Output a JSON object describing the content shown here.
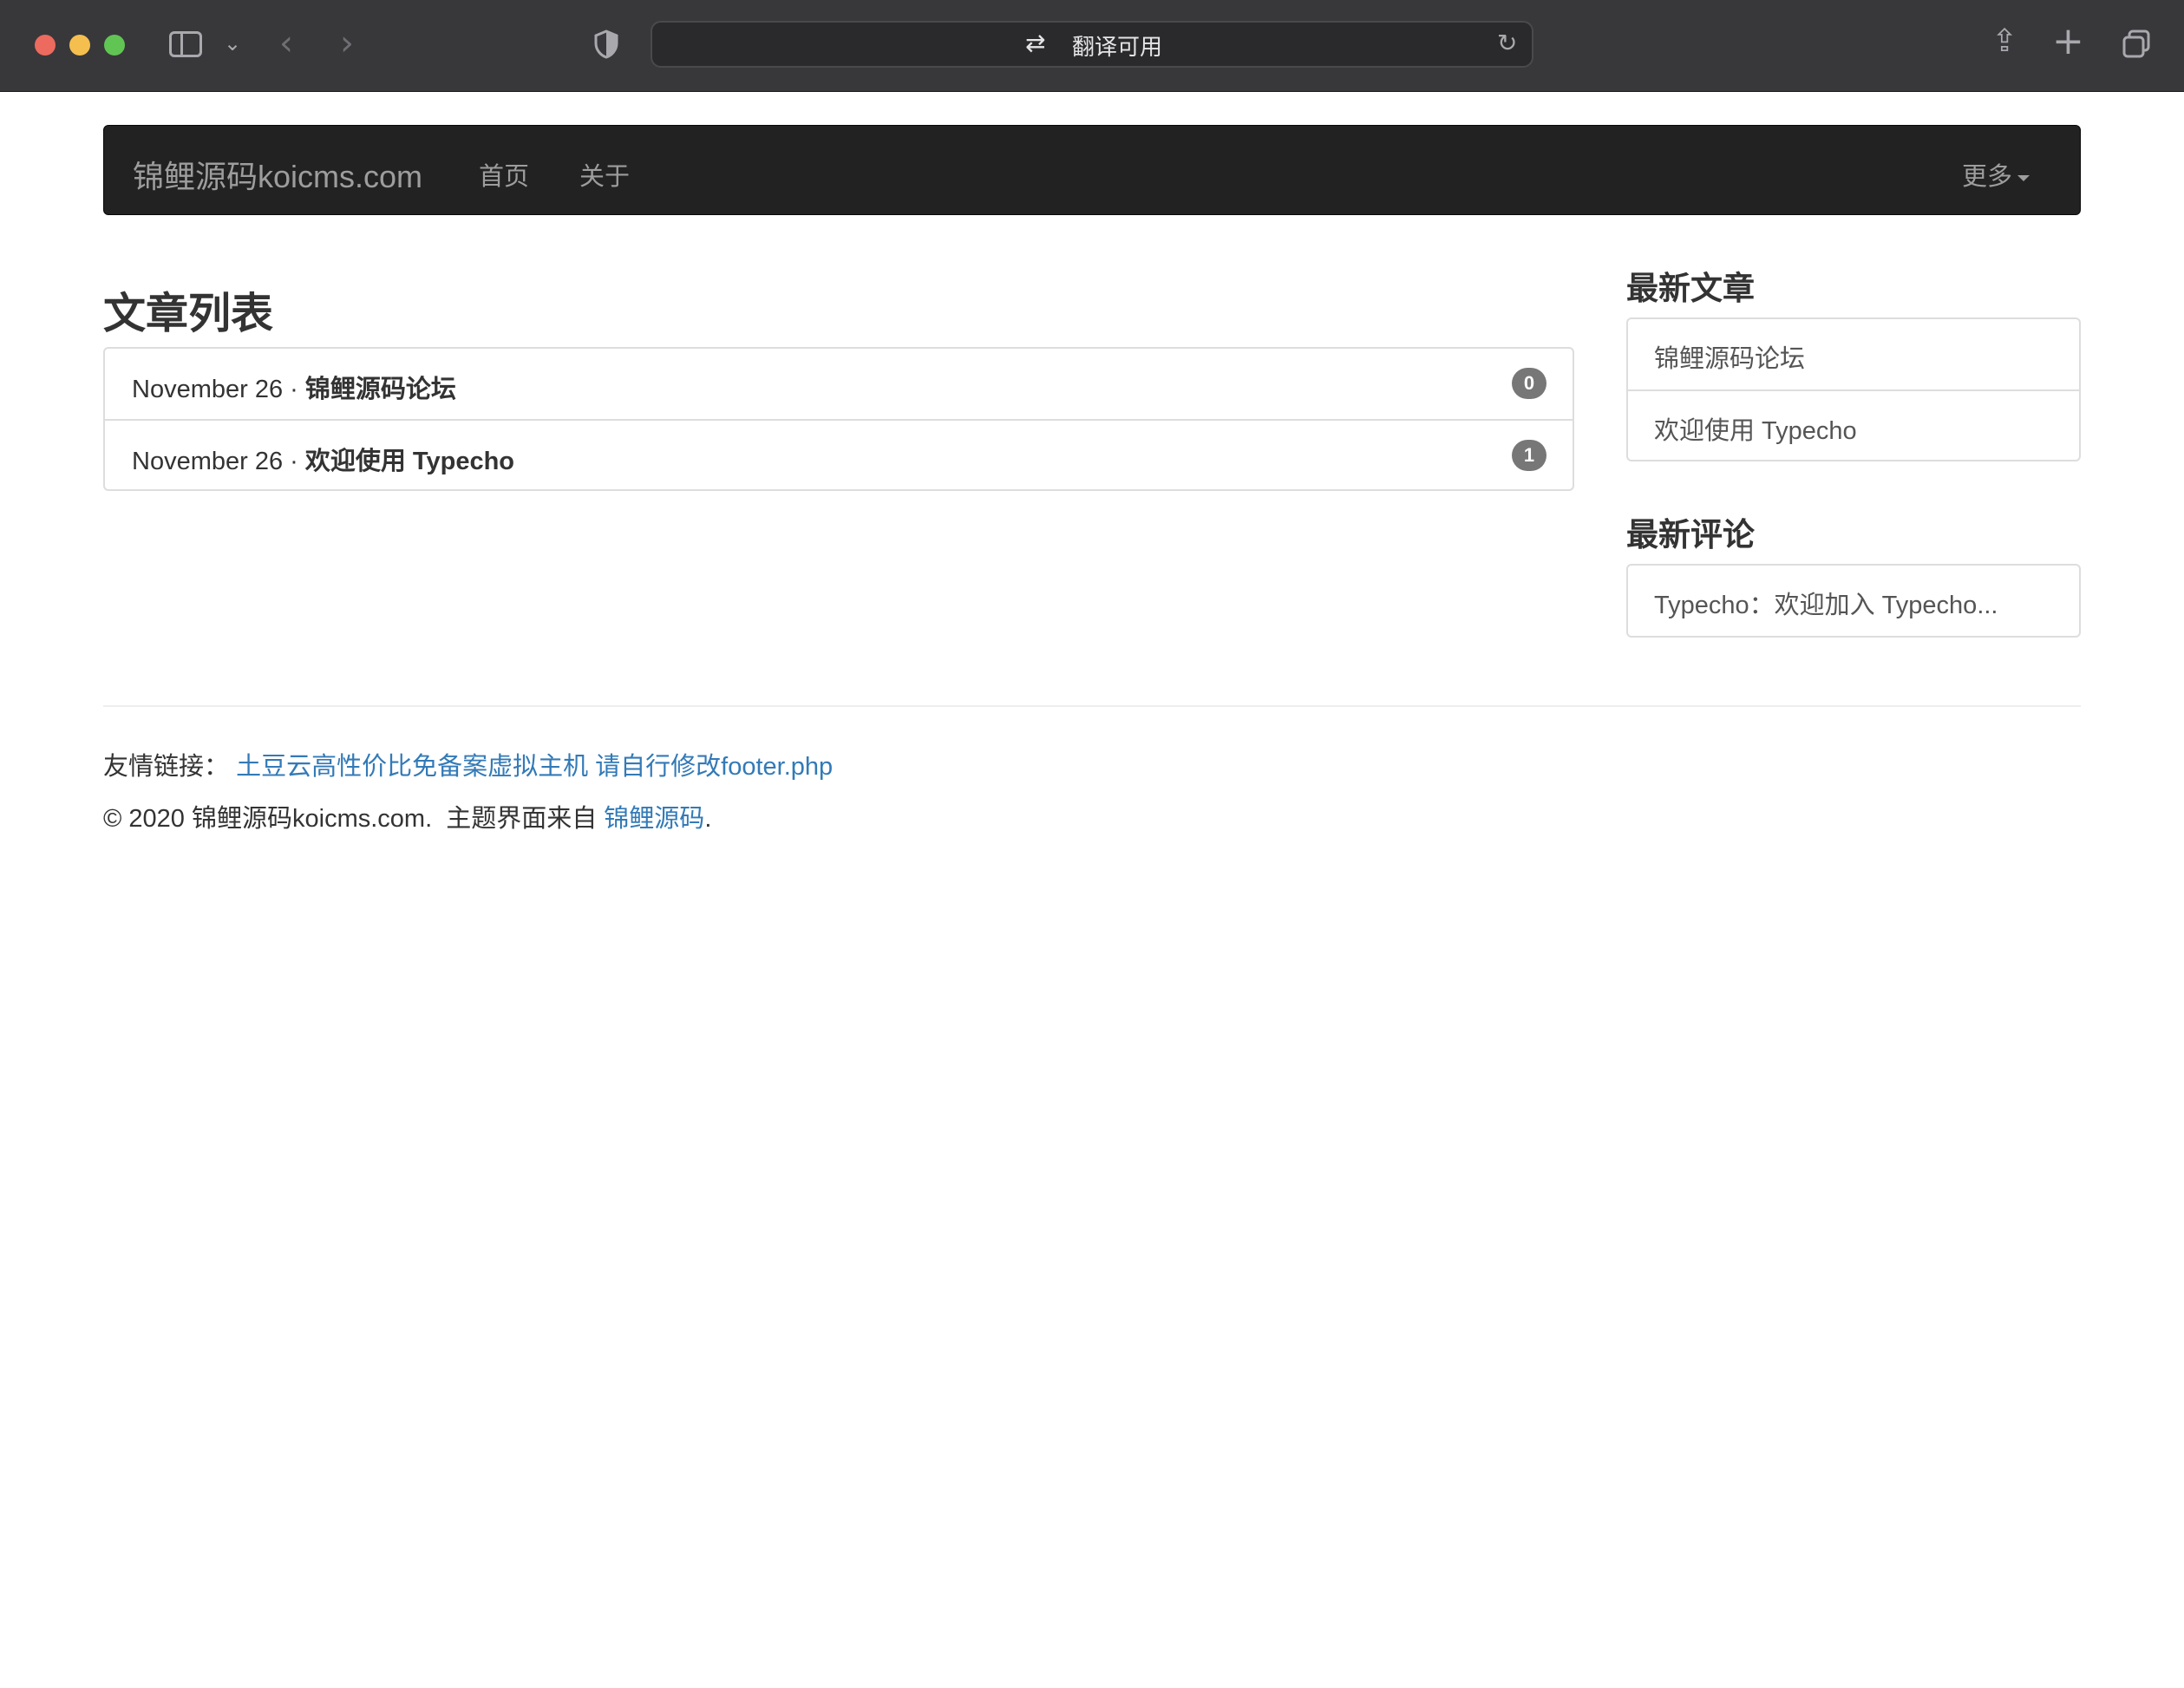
{
  "browser": {
    "address_text": "翻译可用",
    "icons": {
      "sidebar": "sidebar-icon",
      "chevron": "chevron-down-icon",
      "back": "back-arrow-icon",
      "forward": "forward-arrow-icon",
      "privacy": "shield-icon",
      "translate": "translate-icon",
      "reload": "reload-icon",
      "share": "share-icon",
      "new_tab": "plus-icon",
      "tabs": "tab-overview-icon"
    }
  },
  "navbar": {
    "brand": "锦鲤源码koicms.com",
    "links": [
      "首页",
      "关于"
    ],
    "more": "更多"
  },
  "main": {
    "title": "文章列表",
    "posts": [
      {
        "date": "November 26",
        "sep": " · ",
        "title": "锦鲤源码论坛",
        "comments": "0"
      },
      {
        "date": "November 26",
        "sep": " · ",
        "title": "欢迎使用 Typecho",
        "comments": "1"
      }
    ]
  },
  "sidebar": {
    "recent_heading": "最新文章",
    "recent": [
      "锦鲤源码论坛",
      "欢迎使用 Typecho"
    ],
    "comments_heading": "最新评论",
    "comments": [
      "Typecho：欢迎加入 Typecho..."
    ]
  },
  "footer": {
    "links_label": "友情链接：",
    "links": [
      "土豆云高性价比免备案虚拟主机",
      "请自行修改footer.php"
    ],
    "copyright_prefix": "© 2020 锦鲤源码koicms.com.  主题界面来自 ",
    "theme_link": "锦鲤源码",
    "copyright_suffix": "."
  },
  "colors": {
    "chrome": "#38383b",
    "navbar": "#222222",
    "link": "#337ab7",
    "badge": "#777777"
  }
}
